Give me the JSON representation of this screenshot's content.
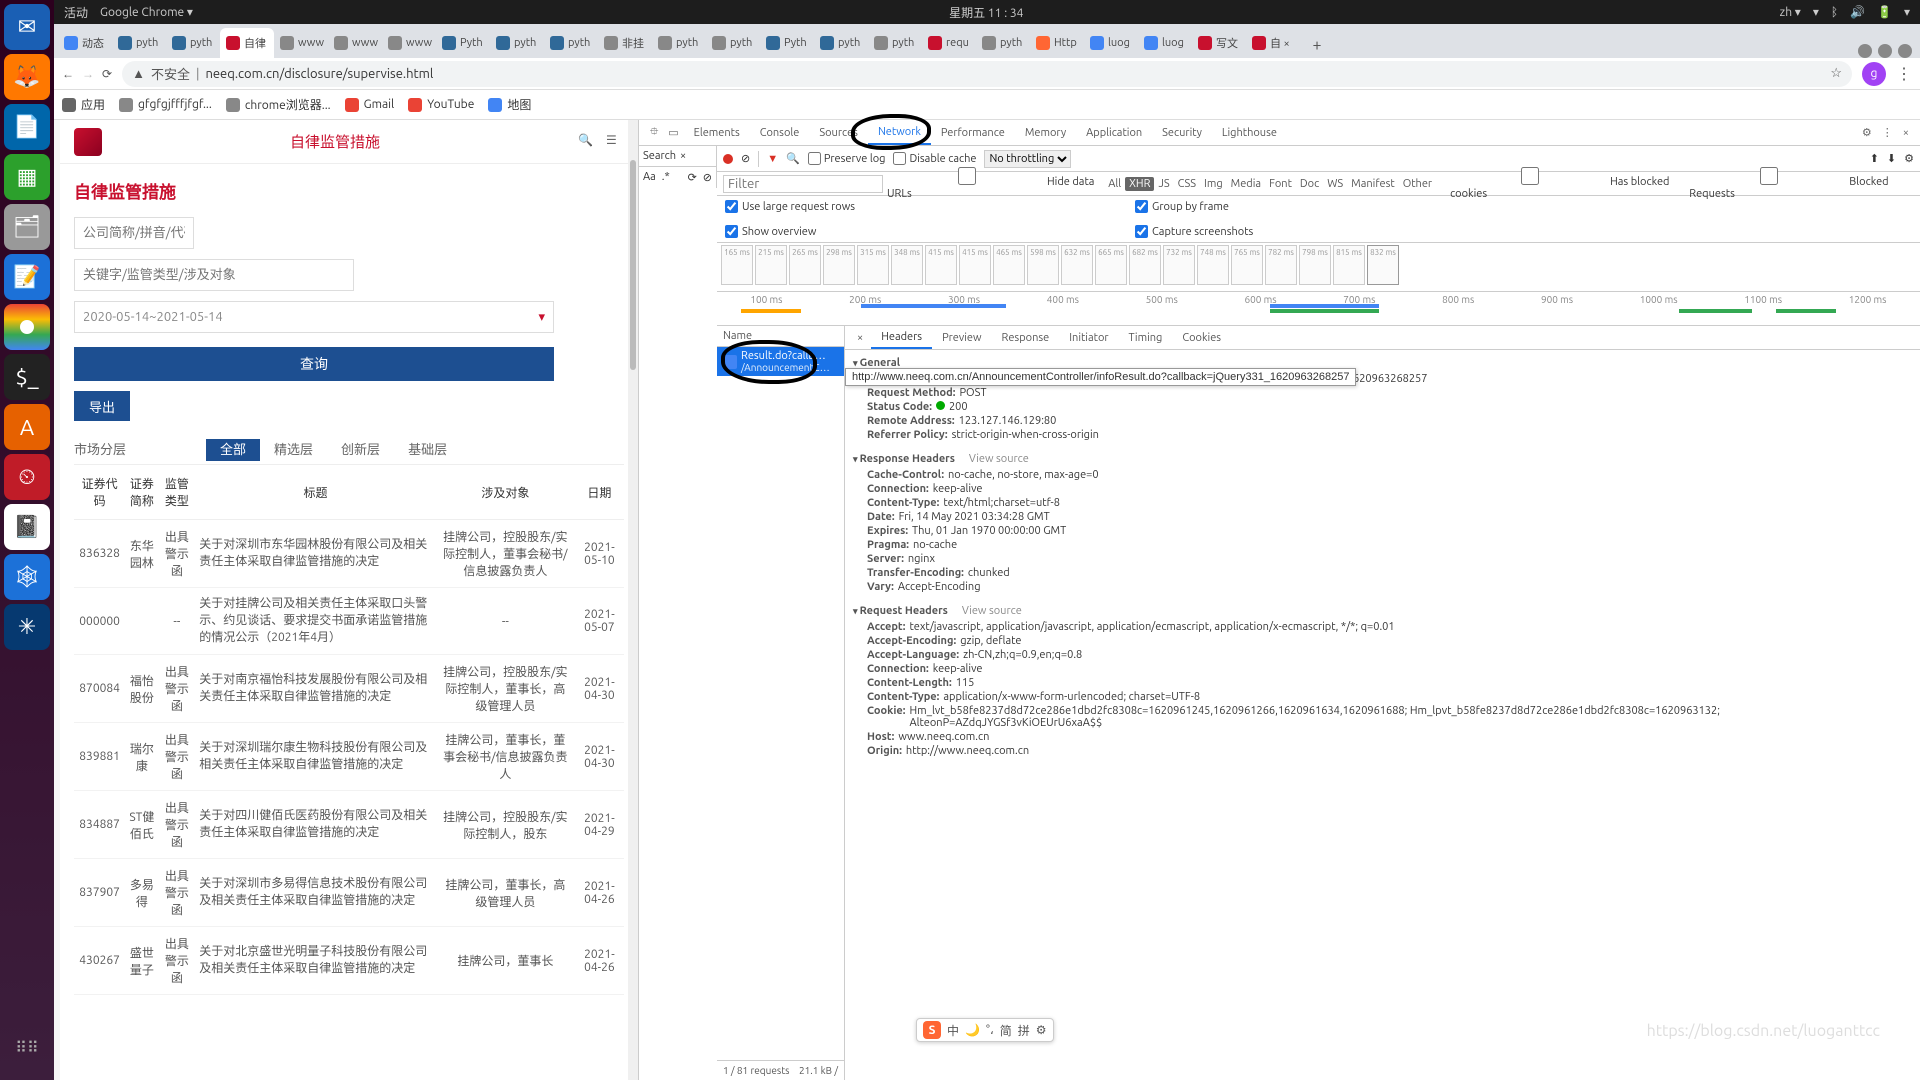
{
  "topbar": {
    "activities": "活动",
    "chrome": "Google Chrome ▾",
    "clock": "星期五 11 : 34",
    "lang": "zh ▾"
  },
  "browser_tabs": [
    {
      "fav": "blue",
      "label": "动态"
    },
    {
      "fav": "py",
      "label": "pyth"
    },
    {
      "fav": "py",
      "label": "pyth"
    },
    {
      "fav": "red",
      "label": "自律",
      "active": true
    },
    {
      "fav": "grey",
      "label": "www"
    },
    {
      "fav": "grey",
      "label": "www"
    },
    {
      "fav": "grey",
      "label": "www"
    },
    {
      "fav": "py",
      "label": "Pyth"
    },
    {
      "fav": "py",
      "label": "pyth"
    },
    {
      "fav": "py",
      "label": "pyth"
    },
    {
      "fav": "grey",
      "label": "非挂"
    },
    {
      "fav": "grey",
      "label": "pyth"
    },
    {
      "fav": "grey",
      "label": "pyth"
    },
    {
      "fav": "py",
      "label": "Pyth"
    },
    {
      "fav": "py",
      "label": "pyth"
    },
    {
      "fav": "grey",
      "label": "pyth"
    },
    {
      "fav": "red",
      "label": "requ"
    },
    {
      "fav": "grey",
      "label": "pyth"
    },
    {
      "fav": "orange",
      "label": "Http"
    },
    {
      "fav": "blue",
      "label": "luog"
    },
    {
      "fav": "blue",
      "label": "luog"
    },
    {
      "fav": "red",
      "label": "写文"
    },
    {
      "fav": "red",
      "label": "自 ×"
    }
  ],
  "addrbar": {
    "insecure": "不安全",
    "url": "neeq.com.cn/disclosure/supervise.html",
    "star": "☆",
    "profile": "g",
    "menu": "⋮"
  },
  "bookmarks": [
    {
      "icon": "grid",
      "label": "应用"
    },
    {
      "icon": "grey",
      "label": "gfgfgjfffjfgf..."
    },
    {
      "icon": "grey",
      "label": "chrome浏览器..."
    },
    {
      "icon": "red",
      "label": "Gmail"
    },
    {
      "icon": "red",
      "label": "YouTube"
    },
    {
      "icon": "blue",
      "label": "地图"
    }
  ],
  "page": {
    "header_title": "自律监管措施",
    "h3": "自律监管措施",
    "ph_company": "公司简称/拼音/代码",
    "ph_keyword": "关键字/监管类型/涉及对象",
    "date_range": "2020-05-14~2021-05-14",
    "btn_query": "查询",
    "btn_export": "导出",
    "tier_label": "市场分层",
    "tiers": [
      "全部",
      "精选层",
      "创新层",
      "基础层"
    ],
    "columns": [
      "证券代码",
      "证券简称",
      "监管类型",
      "标题",
      "涉及对象",
      "日期"
    ],
    "rows": [
      {
        "code": "836328",
        "name": "东华园林",
        "type": "出具警示函",
        "title": "关于对深圳市东华园林股份有限公司及相关责任主体采取自律监管措施的决定",
        "obj": "挂牌公司，控股股东/实际控制人，董事会秘书/信息披露负责人",
        "date": "2021-05-10"
      },
      {
        "code": "000000",
        "name": "",
        "type": "--",
        "title": "关于对挂牌公司及相关责任主体采取口头警示、约见谈话、要求提交书面承诺监管措施的情况公示（2021年4月）",
        "obj": "--",
        "date": "2021-05-07"
      },
      {
        "code": "870084",
        "name": "福怡股份",
        "type": "出具警示函",
        "title": "关于对南京福怡科技发展股份有限公司及相关责任主体采取自律监管措施的决定",
        "obj": "挂牌公司，控股股东/实际控制人，董事长，高级管理人员",
        "date": "2021-04-30"
      },
      {
        "code": "839881",
        "name": "瑞尔康",
        "type": "出具警示函",
        "title": "关于对深圳瑞尔康生物科技股份有限公司及相关责任主体采取自律监管措施的决定",
        "obj": "挂牌公司，董事长，董事会秘书/信息披露负责人",
        "date": "2021-04-30"
      },
      {
        "code": "834887",
        "name": "ST健佰氏",
        "type": "出具警示函",
        "title": "关于对四川健佰氏医药股份有限公司及相关责任主体采取自律监管措施的决定",
        "obj": "挂牌公司，控股股东/实际控制人，股东",
        "date": "2021-04-29"
      },
      {
        "code": "837907",
        "name": "多易得",
        "type": "出具警示函",
        "title": "关于对深圳市多易得信息技术股份有限公司及相关责任主体采取自律监管措施的决定",
        "obj": "挂牌公司，董事长，高级管理人员",
        "date": "2021-04-26"
      },
      {
        "code": "430267",
        "name": "盛世量子",
        "type": "出具警示函",
        "title": "关于对北京盛世光明量子科技股份有限公司及相关责任主体采取自律监管措施的决定",
        "obj": "挂牌公司，董事长",
        "date": "2021-04-26"
      }
    ]
  },
  "devtools": {
    "panels": [
      "Elements",
      "Console",
      "Sources",
      "Network",
      "Performance",
      "Memory",
      "Application",
      "Security",
      "Lighthouse"
    ],
    "active_panel": "Network",
    "search": "Search",
    "toolbar": {
      "preserve": "Preserve log",
      "disable_cache": "Disable cache",
      "throttle": "No throttling"
    },
    "filter_types": [
      "All",
      "XHR",
      "JS",
      "CSS",
      "Img",
      "Media",
      "Font",
      "Doc",
      "WS",
      "Manifest",
      "Other"
    ],
    "filter_active": "XHR",
    "hide_urls": "Hide data URLs",
    "blocked_cookies": "Has blocked cookies",
    "blocked_req": "Blocked Requests",
    "large_rows": "Use large request rows",
    "show_ov": "Show overview",
    "by_frame": "Group by frame",
    "screenshots": "Capture screenshots",
    "thumb_times": [
      "165 ms",
      "215 ms",
      "265 ms",
      "298 ms",
      "315 ms",
      "348 ms",
      "415 ms",
      "415 ms",
      "465 ms",
      "598 ms",
      "632 ms",
      "665 ms",
      "682 ms",
      "732 ms",
      "748 ms",
      "765 ms",
      "782 ms",
      "798 ms",
      "815 ms",
      "832 ms"
    ],
    "timeline_ticks": [
      "100 ms",
      "200 ms",
      "300 ms",
      "400 ms",
      "500 ms",
      "600 ms",
      "700 ms",
      "800 ms",
      "900 ms",
      "1000 ms",
      "1100 ms",
      "1200 ms"
    ],
    "name_hdr": "Name",
    "selected_req_line1": "Result.do?callb…",
    "selected_req_line2": "/AnnouncementC…",
    "tooltip": "http://www.neeq.com.cn/AnnouncementController/infoResult.do?callback=jQuery331_1620963268257",
    "req_status": {
      "count": "1 / 81 requests",
      "size": "21.1 kB /"
    },
    "detail_tabs": [
      "Headers",
      "Preview",
      "Response",
      "Initiator",
      "Timing",
      "Cookies"
    ],
    "general_h": "General",
    "general_tail": "ack=jQuery331_1620963268257",
    "general": [
      {
        "k": "Request Method:",
        "v": "POST"
      },
      {
        "k": "Status Code:",
        "v": "200",
        "dot": true
      },
      {
        "k": "Remote Address:",
        "v": "123.127.146.129:80"
      },
      {
        "k": "Referrer Policy:",
        "v": "strict-origin-when-cross-origin"
      }
    ],
    "resp_h": "Response Headers",
    "view_source": "View source",
    "response": [
      {
        "k": "Cache-Control:",
        "v": "no-cache, no-store, max-age=0"
      },
      {
        "k": "Connection:",
        "v": "keep-alive"
      },
      {
        "k": "Content-Type:",
        "v": "text/html;charset=utf-8"
      },
      {
        "k": "Date:",
        "v": "Fri, 14 May 2021 03:34:28 GMT"
      },
      {
        "k": "Expires:",
        "v": "Thu, 01 Jan 1970 00:00:00 GMT"
      },
      {
        "k": "Pragma:",
        "v": "no-cache"
      },
      {
        "k": "Server:",
        "v": "nginx"
      },
      {
        "k": "Transfer-Encoding:",
        "v": "chunked"
      },
      {
        "k": "Vary:",
        "v": "Accept-Encoding"
      }
    ],
    "req_h": "Request Headers",
    "request": [
      {
        "k": "Accept:",
        "v": "text/javascript, application/javascript, application/ecmascript, application/x-ecmascript, */*; q=0.01"
      },
      {
        "k": "Accept-Encoding:",
        "v": "gzip, deflate"
      },
      {
        "k": "Accept-Language:",
        "v": "zh-CN,zh;q=0.9,en;q=0.8"
      },
      {
        "k": "Connection:",
        "v": "keep-alive"
      },
      {
        "k": "Content-Length:",
        "v": "115"
      },
      {
        "k": "Content-Type:",
        "v": "application/x-www-form-urlencoded; charset=UTF-8"
      },
      {
        "k": "Cookie:",
        "v": "Hm_lvt_b58fe8237d8d72ce286e1dbd2fc8308c=1620961245,1620961266,1620961634,1620961688; Hm_lpvt_b58fe8237d8d72ce286e1dbd2fc8308c=1620963132; AlteonP=AZdqJYGSf3vKiOEUrU6xaA$$"
      },
      {
        "k": "Host:",
        "v": "www.neeq.com.cn"
      },
      {
        "k": "Origin:",
        "v": "http://www.neeq.com.cn"
      }
    ]
  },
  "ime": [
    "中",
    "",
    "简",
    "拼"
  ]
}
